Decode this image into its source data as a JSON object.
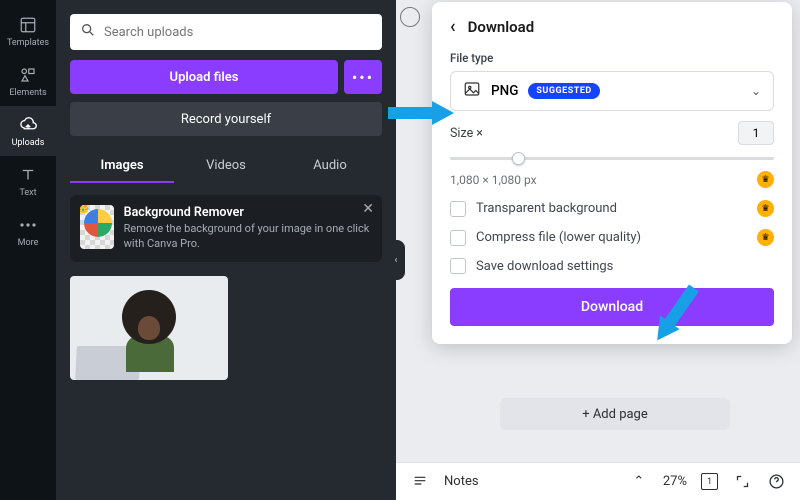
{
  "rail": {
    "items": [
      {
        "label": "Templates"
      },
      {
        "label": "Elements"
      },
      {
        "label": "Uploads"
      },
      {
        "label": "Text"
      },
      {
        "label": "More"
      }
    ]
  },
  "panel": {
    "search_placeholder": "Search uploads",
    "upload_btn": "Upload files",
    "record_btn": "Record yourself",
    "tabs": [
      "Images",
      "Videos",
      "Audio"
    ],
    "promo": {
      "title": "Background Remover",
      "desc": "Remove the background of your image in one click with Canva Pro."
    }
  },
  "popover": {
    "title": "Download",
    "filetype_label": "File type",
    "filetype_value": "PNG",
    "filetype_badge": "SUGGESTED",
    "size_label": "Size ×",
    "size_value": "1",
    "dimensions": "1,080 × 1,080 px",
    "opts": {
      "transparent": "Transparent background",
      "compress": "Compress file (lower quality)",
      "save": "Save download settings"
    },
    "download_btn": "Download"
  },
  "canvas": {
    "add_page": "+ Add page"
  },
  "footer": {
    "notes": "Notes",
    "zoom": "27%",
    "page": "1"
  },
  "colors": {
    "accent": "#8b3dff",
    "badge": "#1544ff",
    "arrow": "#18a0e6"
  }
}
